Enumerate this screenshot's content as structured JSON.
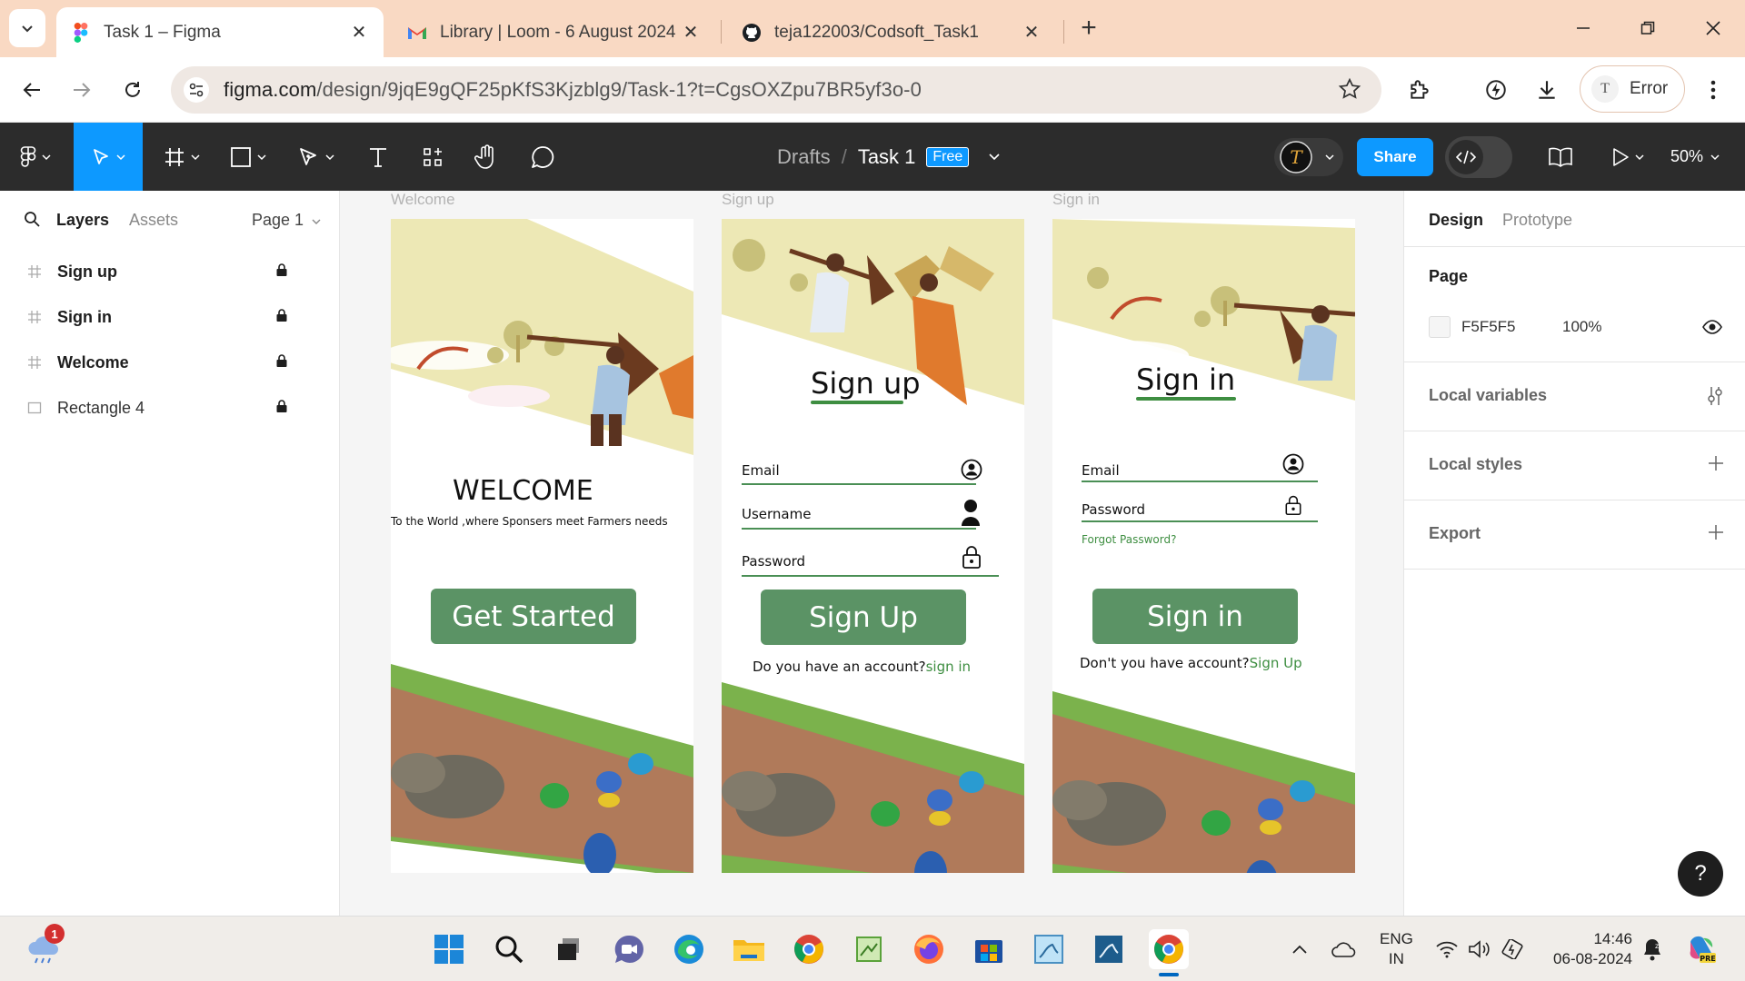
{
  "browser": {
    "tabs": [
      {
        "title": "Task 1 – Figma",
        "active": true
      },
      {
        "title": "Library | Loom - 6 August 2024",
        "active": false
      },
      {
        "title": "teja122003/Codsoft_Task1",
        "active": false
      }
    ],
    "url_host": "figma.com",
    "url_path": "/design/9jqE9gQF25pKfS3Kjzblg9/Task-1?t=CgsOXZpu7BR5yf3o-0",
    "profile_initial": "T",
    "profile_label": "Error"
  },
  "figma": {
    "breadcrumb": {
      "drafts": "Drafts",
      "separator": "/",
      "file": "Task 1",
      "plan_badge": "Free"
    },
    "share_label": "Share",
    "zoom": "50%",
    "left_panel": {
      "tab_layers": "Layers",
      "tab_assets": "Assets",
      "page_selector": "Page 1",
      "layers": [
        {
          "name": "Sign up",
          "type": "frame",
          "locked": true
        },
        {
          "name": "Sign in",
          "type": "frame",
          "locked": true
        },
        {
          "name": "Welcome",
          "type": "frame",
          "locked": true
        },
        {
          "name": "Rectangle 4",
          "type": "rectangle",
          "locked": true
        }
      ]
    },
    "right_panel": {
      "tab_design": "Design",
      "tab_prototype": "Prototype",
      "page_heading": "Page",
      "page_color_hex": "F5F5F5",
      "page_color_opacity": "100%",
      "sections": [
        "Local variables",
        "Local styles",
        "Export"
      ]
    },
    "help": "?"
  },
  "canvas": {
    "frames": {
      "welcome": {
        "label": "Welcome",
        "heading": "WELCOME",
        "tagline": "To the World ,where Sponsers meet Farmers needs",
        "button": "Get Started"
      },
      "signup": {
        "label": "Sign up",
        "heading": "Sign up",
        "fields": [
          "Email",
          "Username",
          "Password"
        ],
        "button": "Sign Up",
        "helper_text": "Do you have an account?",
        "helper_link": "sign in"
      },
      "signin": {
        "label": "Sign in",
        "heading": "Sign in",
        "fields": [
          "Email",
          "Password"
        ],
        "forgot": "Forgot Password?",
        "button": "Sign in",
        "helper_text": "Don't you have account?",
        "helper_link": "Sign Up"
      }
    }
  },
  "taskbar": {
    "weather_badge": "1",
    "lang_line1": "ENG",
    "lang_line2": "IN",
    "time": "14:46",
    "date": "06-08-2024"
  },
  "colors": {
    "accent_blue": "#0d99ff",
    "figma_dark": "#2c2c2c",
    "brand_green": "#5b9365",
    "link_green": "#3e8e41",
    "chrome_tab_bg": "#f9d9c3"
  }
}
